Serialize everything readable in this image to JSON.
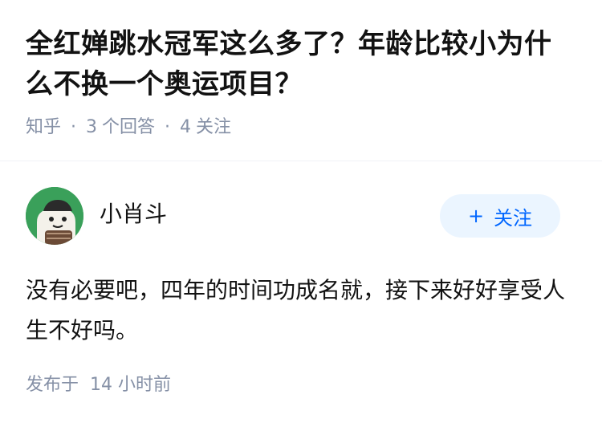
{
  "question": {
    "title": "全红婵跳水冠军这么多了？年龄比较小为什么不换一个奥运项目？",
    "source": "知乎",
    "answer_count": "3",
    "answer_label": "个回答",
    "follower_count": "4",
    "follower_label": "关注",
    "separator": "·"
  },
  "answer": {
    "author": {
      "name": "小肖斗",
      "avatar_icon": "avatar-cartoon-icon"
    },
    "follow_button": {
      "plus": "+",
      "label": "关注"
    },
    "content": "没有必要吧，四年的时间功成名就，接下来好好享受人生不好吗。",
    "publish_label": "发布于",
    "publish_time": "14 小时前"
  },
  "colors": {
    "text": "#121212",
    "meta": "#8590a6",
    "accent": "#0066ff",
    "button_bg": "#ebf5ff",
    "avatar_bg": "#3aa05a"
  }
}
